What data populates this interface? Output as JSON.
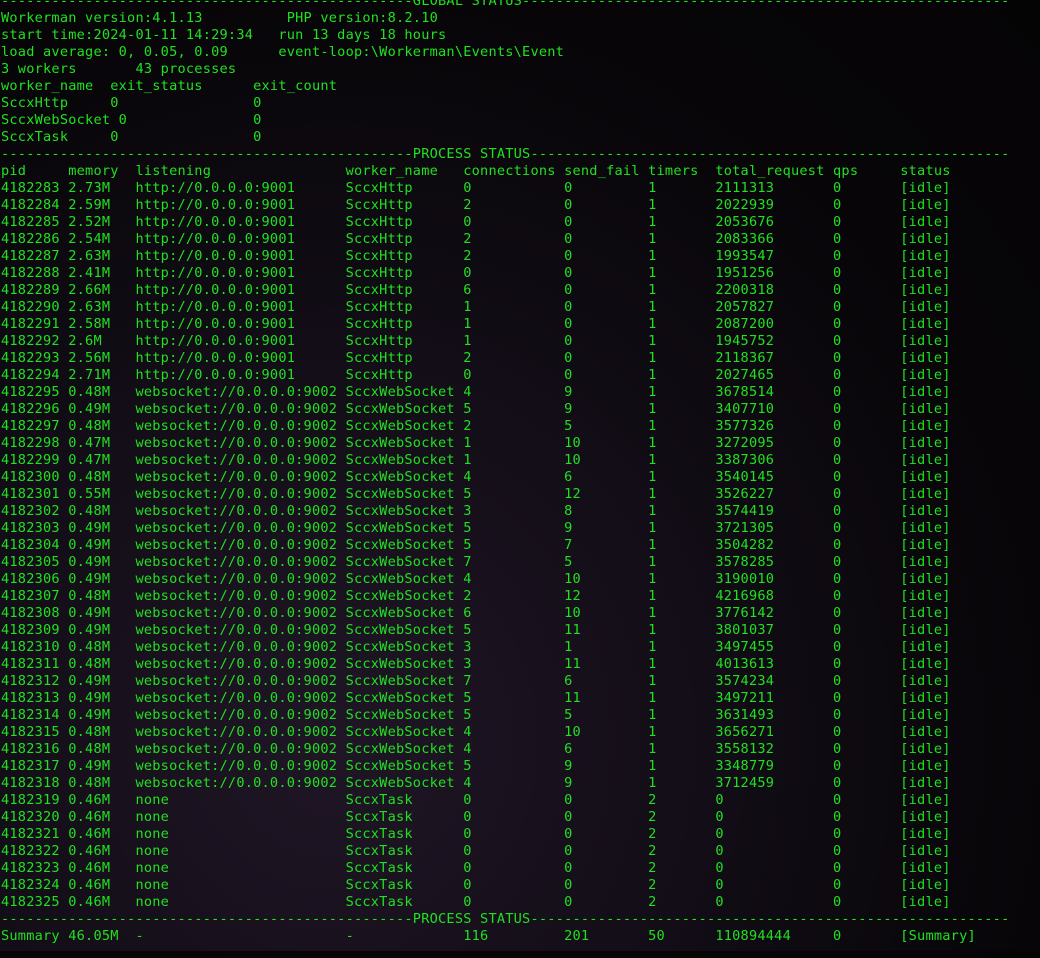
{
  "terminal": {
    "text_color": "#20e020",
    "background_color": "#0a070b",
    "lines": [
      "-------------------------------------------------GLOBAL STATUS----------------------------------------------------------",
      "Workerman version:4.1.13          PHP version:8.2.10",
      "start time:2024-01-11 14:29:34   run 13 days 18 hours",
      "load average: 0, 0.05, 0.09      event-loop:\\Workerman\\Events\\Event",
      "3 workers       43 processes",
      "worker_name  exit_status      exit_count",
      "SccxHttp     0                0",
      "SccxWebSocket 0               0",
      "SccxTask     0                0",
      "-------------------------------------------------PROCESS STATUS---------------------------------------------------------",
      "pid     memory  listening                worker_name   connections send_fail timers  total_request qps     status",
      "4182283 2.73M   http://0.0.0.0:9001      SccxHttp      0           0         1       2111313       0       [idle]",
      "4182284 2.59M   http://0.0.0.0:9001      SccxHttp      2           0         1       2022939       0       [idle]",
      "4182285 2.52M   http://0.0.0.0:9001      SccxHttp      0           0         1       2053676       0       [idle]",
      "4182286 2.54M   http://0.0.0.0:9001      SccxHttp      2           0         1       2083366       0       [idle]",
      "4182287 2.63M   http://0.0.0.0:9001      SccxHttp      2           0         1       1993547       0       [idle]",
      "4182288 2.41M   http://0.0.0.0:9001      SccxHttp      0           0         1       1951256       0       [idle]",
      "4182289 2.66M   http://0.0.0.0:9001      SccxHttp      6           0         1       2200318       0       [idle]",
      "4182290 2.63M   http://0.0.0.0:9001      SccxHttp      1           0         1       2057827       0       [idle]",
      "4182291 2.58M   http://0.0.0.0:9001      SccxHttp      1           0         1       2087200       0       [idle]",
      "4182292 2.6M    http://0.0.0.0:9001      SccxHttp      1           0         1       1945752       0       [idle]",
      "4182293 2.56M   http://0.0.0.0:9001      SccxHttp      2           0         1       2118367       0       [idle]",
      "4182294 2.71M   http://0.0.0.0:9001      SccxHttp      0           0         1       2027465       0       [idle]",
      "4182295 0.48M   websocket://0.0.0.0:9002 SccxWebSocket 4           9         1       3678514       0       [idle]",
      "4182296 0.49M   websocket://0.0.0.0:9002 SccxWebSocket 5           9         1       3407710       0       [idle]",
      "4182297 0.48M   websocket://0.0.0.0:9002 SccxWebSocket 2           5         1       3577326       0       [idle]",
      "4182298 0.47M   websocket://0.0.0.0:9002 SccxWebSocket 1           10        1       3272095       0       [idle]",
      "4182299 0.47M   websocket://0.0.0.0:9002 SccxWebSocket 1           10        1       3387306       0       [idle]",
      "4182300 0.48M   websocket://0.0.0.0:9002 SccxWebSocket 4           6         1       3540145       0       [idle]",
      "4182301 0.55M   websocket://0.0.0.0:9002 SccxWebSocket 5           12        1       3526227       0       [idle]",
      "4182302 0.48M   websocket://0.0.0.0:9002 SccxWebSocket 3           8         1       3574419       0       [idle]",
      "4182303 0.49M   websocket://0.0.0.0:9002 SccxWebSocket 5           9         1       3721305       0       [idle]",
      "4182304 0.49M   websocket://0.0.0.0:9002 SccxWebSocket 5           7         1       3504282       0       [idle]",
      "4182305 0.49M   websocket://0.0.0.0:9002 SccxWebSocket 7           5         1       3578285       0       [idle]",
      "4182306 0.49M   websocket://0.0.0.0:9002 SccxWebSocket 4           10        1       3190010       0       [idle]",
      "4182307 0.48M   websocket://0.0.0.0:9002 SccxWebSocket 2           12        1       4216968       0       [idle]",
      "4182308 0.49M   websocket://0.0.0.0:9002 SccxWebSocket 6           10        1       3776142       0       [idle]",
      "4182309 0.49M   websocket://0.0.0.0:9002 SccxWebSocket 5           11        1       3801037       0       [idle]",
      "4182310 0.48M   websocket://0.0.0.0:9002 SccxWebSocket 3           1         1       3497455       0       [idle]",
      "4182311 0.48M   websocket://0.0.0.0:9002 SccxWebSocket 3           11        1       4013613       0       [idle]",
      "4182312 0.49M   websocket://0.0.0.0:9002 SccxWebSocket 7           6         1       3574234       0       [idle]",
      "4182313 0.49M   websocket://0.0.0.0:9002 SccxWebSocket 5           11        1       3497211       0       [idle]",
      "4182314 0.49M   websocket://0.0.0.0:9002 SccxWebSocket 5           5         1       3631493       0       [idle]",
      "4182315 0.48M   websocket://0.0.0.0:9002 SccxWebSocket 4           10        1       3656271       0       [idle]",
      "4182316 0.48M   websocket://0.0.0.0:9002 SccxWebSocket 4           6         1       3558132       0       [idle]",
      "4182317 0.49M   websocket://0.0.0.0:9002 SccxWebSocket 5           9         1       3348779       0       [idle]",
      "4182318 0.48M   websocket://0.0.0.0:9002 SccxWebSocket 4           9         1       3712459       0       [idle]",
      "4182319 0.46M   none                     SccxTask      0           0         2       0             0       [idle]",
      "4182320 0.46M   none                     SccxTask      0           0         2       0             0       [idle]",
      "4182321 0.46M   none                     SccxTask      0           0         2       0             0       [idle]",
      "4182322 0.46M   none                     SccxTask      0           0         2       0             0       [idle]",
      "4182323 0.46M   none                     SccxTask      0           0         2       0             0       [idle]",
      "4182324 0.46M   none                     SccxTask      0           0         2       0             0       [idle]",
      "4182325 0.46M   none                     SccxTask      0           0         2       0             0       [idle]",
      "-------------------------------------------------PROCESS STATUS---------------------------------------------------------",
      "Summary 46.05M  -                        -             116         201       50      110894444     0       [Summary]"
    ]
  }
}
